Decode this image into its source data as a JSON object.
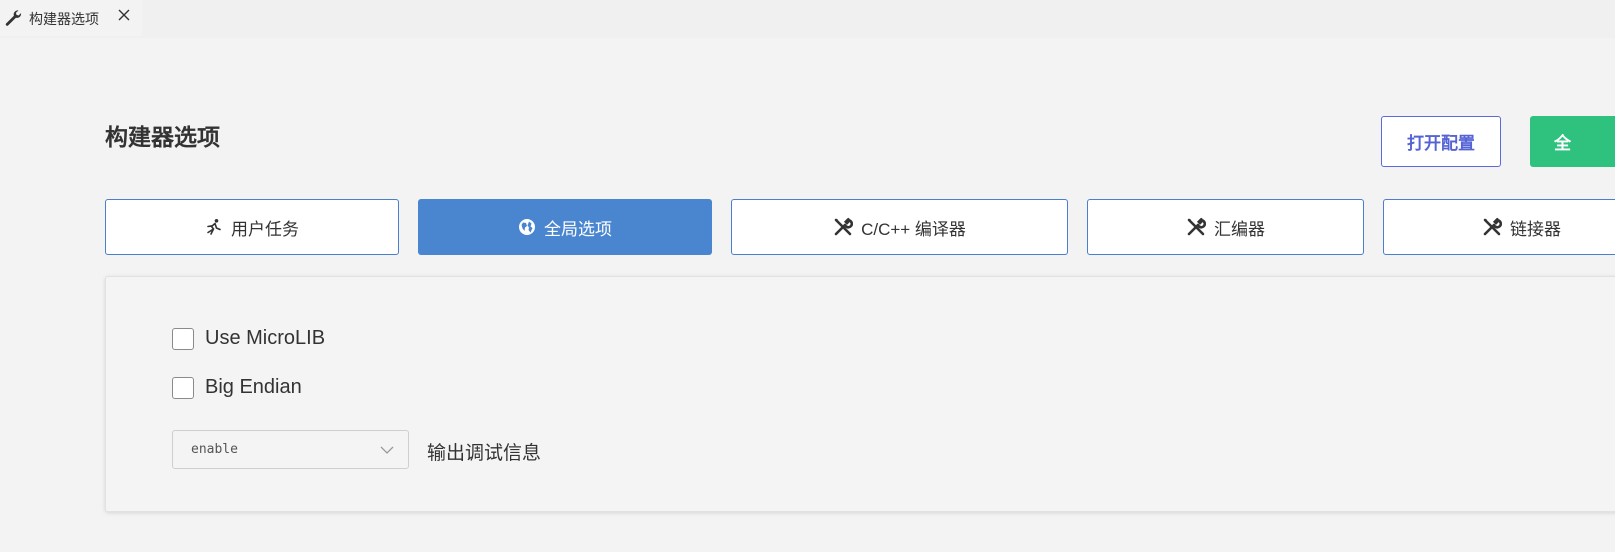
{
  "tab": {
    "title": "构建器选项",
    "icon": "wrench-icon",
    "close_glyph": "✕"
  },
  "header": {
    "title": "构建器选项",
    "open_config_label": "打开配置",
    "green_button_label": "全",
    "green_button_color": "#2ec27e"
  },
  "nav": {
    "active_color": "#4a86d0",
    "items": [
      {
        "label": "用户任务",
        "icon": "runner-icon"
      },
      {
        "label": "全局选项",
        "icon": "globe-icon"
      },
      {
        "label": "C/C++ 编译器",
        "icon": "tools-icon"
      },
      {
        "label": "汇编器",
        "icon": "tools-icon"
      },
      {
        "label": "链接器",
        "icon": "tools-icon"
      }
    ]
  },
  "options": {
    "use_microlib": {
      "label": "Use MicroLIB",
      "checked": false
    },
    "big_endian": {
      "label": "Big Endian",
      "checked": false
    },
    "debug_info": {
      "value": "enable",
      "label": "输出调试信息"
    }
  }
}
